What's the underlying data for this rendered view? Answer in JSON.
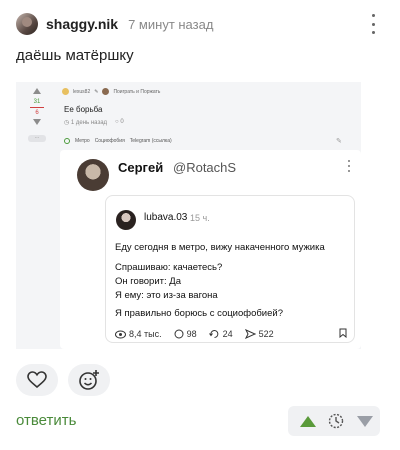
{
  "comment": {
    "username": "shaggy.nik",
    "time": "7 минут назад",
    "text": "даёшь матёршку",
    "reply_label": "ответить"
  },
  "embed": {
    "rating": {
      "plus": "31",
      "minus": "6",
      "more": "···"
    },
    "post_author": "lexus82",
    "community": "Поиграть и Поржать",
    "post_title": "Ее борьба",
    "post_age": "1 день назад",
    "post_comments": "0",
    "tags": [
      "Метро",
      "Социофобия",
      "Telegram (ссылка)"
    ],
    "tweet": {
      "name": "Сергей",
      "handle": "@RotachS",
      "quote": {
        "name": "lubava.03",
        "time": "15 ч.",
        "lines": [
          "Еду сегодня в метро, вижу накаченного мужика",
          "Спрашиваю: качаетесь?",
          "Он говорит: Да",
          "Я ему: это из-за вагона",
          "Я правильно борюсь с социофобией?"
        ],
        "views": "8,4 тыс.",
        "comments": "98",
        "reposts": "24",
        "shares": "522"
      }
    }
  },
  "colors": {
    "accent_green": "#4a8a3a",
    "vote_up": "#5a9a3a",
    "vote_down": "#9a9ea6"
  }
}
